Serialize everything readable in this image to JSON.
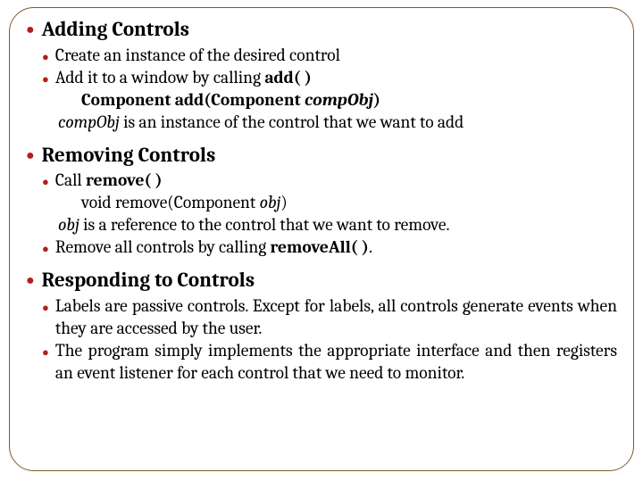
{
  "sections": [
    {
      "title": "Adding Controls",
      "items": [
        {
          "parts": [
            {
              "t": "Create an instance of the desired control"
            }
          ]
        },
        {
          "parts": [
            {
              "t": "Add it to a window by calling "
            },
            {
              "t": "add( )",
              "b": true
            }
          ],
          "sig": [
            {
              "t": "Component add(Component ",
              "b": true
            },
            {
              "t": "compObj",
              "b": true,
              "i": true
            },
            {
              "t": ")",
              "b": true
            }
          ],
          "note": [
            {
              "t": "compObj",
              "i": true
            },
            {
              "t": " is an instance of the control that we want to add"
            }
          ]
        }
      ]
    },
    {
      "title": "Removing Controls",
      "items": [
        {
          "parts": [
            {
              "t": "Call "
            },
            {
              "t": "remove( )",
              "b": true
            }
          ],
          "sig": [
            {
              "t": "void remove(Component "
            },
            {
              "t": "obj",
              "i": true
            },
            {
              "t": ")"
            }
          ],
          "note": [
            {
              "t": "obj",
              "i": true
            },
            {
              "t": " is a reference to the control that we want to remove."
            }
          ]
        },
        {
          "parts": [
            {
              "t": "Remove all controls by calling "
            },
            {
              "t": "removeAll( )",
              "b": true
            },
            {
              "t": "."
            }
          ]
        }
      ]
    },
    {
      "title": "Responding to Controls",
      "items": [
        {
          "justify": true,
          "parts": [
            {
              "t": "Labels are passive controls. Except for labels, all controls generate events when they are accessed by the user."
            }
          ]
        },
        {
          "justify": true,
          "parts": [
            {
              "t": "The program simply implements the appropriate interface and then registers an event listener for each control that we need to monitor."
            }
          ]
        }
      ]
    }
  ]
}
